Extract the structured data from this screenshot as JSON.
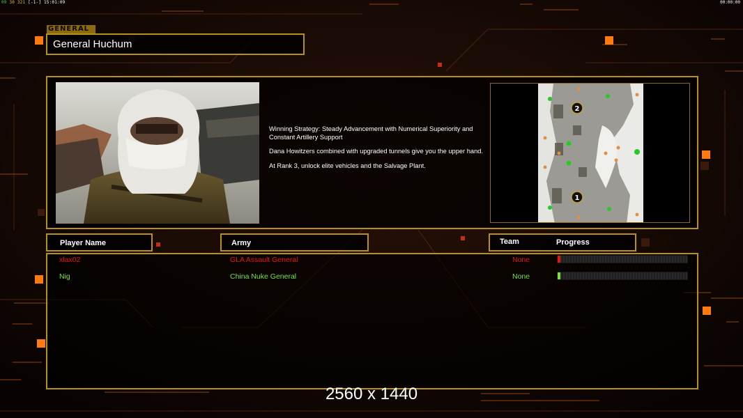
{
  "hud": {
    "fps_a": "09",
    "fps_b": "30",
    "fps_c": "321",
    "fps_d": "[-1-]",
    "clock_left": "15:01:09",
    "clock_right": "00:00:00"
  },
  "general_label": "GENERAL",
  "general_name": "General Huchum",
  "strategy": {
    "p1": "Winning Strategy: Steady Advancement with Numerical Superiority and Constant Artillery Support",
    "p2": "Dana Howitzers combined with upgraded tunnels give you the upper hand.",
    "p3": "At Rank 3, unlock elite vehicles and the Salvage Plant."
  },
  "map": {
    "start_1": "1",
    "start_2": "2"
  },
  "columns": {
    "player_name": "Player Name",
    "army": "Army",
    "team": "Team",
    "progress": "Progress"
  },
  "players": [
    {
      "name": "xlax02",
      "army": "GLA Assault General",
      "team": "None",
      "progress": 0.02,
      "color": "#e01818"
    },
    {
      "name": "Nig",
      "army": "China Nuke General",
      "team": "None",
      "progress": 0.01,
      "color": "#7ce03c"
    }
  ],
  "resolution_label": "2560 x 1440",
  "colors": {
    "gold_border": "#b8901c",
    "accent_orange": "#ff7a10"
  }
}
